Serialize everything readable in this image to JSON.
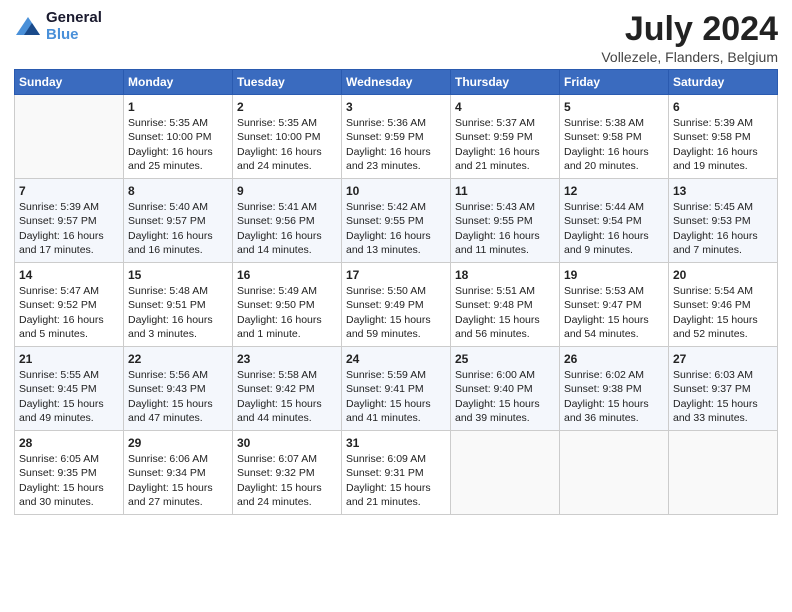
{
  "header": {
    "logo_line1": "General",
    "logo_line2": "Blue",
    "title": "July 2024",
    "subtitle": "Vollezele, Flanders, Belgium"
  },
  "weekdays": [
    "Sunday",
    "Monday",
    "Tuesday",
    "Wednesday",
    "Thursday",
    "Friday",
    "Saturday"
  ],
  "weeks": [
    [
      {
        "empty": true
      },
      {
        "day": "1",
        "sunrise": "5:35 AM",
        "sunset": "10:00 PM",
        "daylight": "16 hours and 25 minutes."
      },
      {
        "day": "2",
        "sunrise": "5:35 AM",
        "sunset": "10:00 PM",
        "daylight": "16 hours and 24 minutes."
      },
      {
        "day": "3",
        "sunrise": "5:36 AM",
        "sunset": "9:59 PM",
        "daylight": "16 hours and 23 minutes."
      },
      {
        "day": "4",
        "sunrise": "5:37 AM",
        "sunset": "9:59 PM",
        "daylight": "16 hours and 21 minutes."
      },
      {
        "day": "5",
        "sunrise": "5:38 AM",
        "sunset": "9:58 PM",
        "daylight": "16 hours and 20 minutes."
      },
      {
        "day": "6",
        "sunrise": "5:39 AM",
        "sunset": "9:58 PM",
        "daylight": "16 hours and 19 minutes."
      }
    ],
    [
      {
        "day": "7",
        "sunrise": "5:39 AM",
        "sunset": "9:57 PM",
        "daylight": "16 hours and 17 minutes."
      },
      {
        "day": "8",
        "sunrise": "5:40 AM",
        "sunset": "9:57 PM",
        "daylight": "16 hours and 16 minutes."
      },
      {
        "day": "9",
        "sunrise": "5:41 AM",
        "sunset": "9:56 PM",
        "daylight": "16 hours and 14 minutes."
      },
      {
        "day": "10",
        "sunrise": "5:42 AM",
        "sunset": "9:55 PM",
        "daylight": "16 hours and 13 minutes."
      },
      {
        "day": "11",
        "sunrise": "5:43 AM",
        "sunset": "9:55 PM",
        "daylight": "16 hours and 11 minutes."
      },
      {
        "day": "12",
        "sunrise": "5:44 AM",
        "sunset": "9:54 PM",
        "daylight": "16 hours and 9 minutes."
      },
      {
        "day": "13",
        "sunrise": "5:45 AM",
        "sunset": "9:53 PM",
        "daylight": "16 hours and 7 minutes."
      }
    ],
    [
      {
        "day": "14",
        "sunrise": "5:47 AM",
        "sunset": "9:52 PM",
        "daylight": "16 hours and 5 minutes."
      },
      {
        "day": "15",
        "sunrise": "5:48 AM",
        "sunset": "9:51 PM",
        "daylight": "16 hours and 3 minutes."
      },
      {
        "day": "16",
        "sunrise": "5:49 AM",
        "sunset": "9:50 PM",
        "daylight": "16 hours and 1 minute."
      },
      {
        "day": "17",
        "sunrise": "5:50 AM",
        "sunset": "9:49 PM",
        "daylight": "15 hours and 59 minutes."
      },
      {
        "day": "18",
        "sunrise": "5:51 AM",
        "sunset": "9:48 PM",
        "daylight": "15 hours and 56 minutes."
      },
      {
        "day": "19",
        "sunrise": "5:53 AM",
        "sunset": "9:47 PM",
        "daylight": "15 hours and 54 minutes."
      },
      {
        "day": "20",
        "sunrise": "5:54 AM",
        "sunset": "9:46 PM",
        "daylight": "15 hours and 52 minutes."
      }
    ],
    [
      {
        "day": "21",
        "sunrise": "5:55 AM",
        "sunset": "9:45 PM",
        "daylight": "15 hours and 49 minutes."
      },
      {
        "day": "22",
        "sunrise": "5:56 AM",
        "sunset": "9:43 PM",
        "daylight": "15 hours and 47 minutes."
      },
      {
        "day": "23",
        "sunrise": "5:58 AM",
        "sunset": "9:42 PM",
        "daylight": "15 hours and 44 minutes."
      },
      {
        "day": "24",
        "sunrise": "5:59 AM",
        "sunset": "9:41 PM",
        "daylight": "15 hours and 41 minutes."
      },
      {
        "day": "25",
        "sunrise": "6:00 AM",
        "sunset": "9:40 PM",
        "daylight": "15 hours and 39 minutes."
      },
      {
        "day": "26",
        "sunrise": "6:02 AM",
        "sunset": "9:38 PM",
        "daylight": "15 hours and 36 minutes."
      },
      {
        "day": "27",
        "sunrise": "6:03 AM",
        "sunset": "9:37 PM",
        "daylight": "15 hours and 33 minutes."
      }
    ],
    [
      {
        "day": "28",
        "sunrise": "6:05 AM",
        "sunset": "9:35 PM",
        "daylight": "15 hours and 30 minutes."
      },
      {
        "day": "29",
        "sunrise": "6:06 AM",
        "sunset": "9:34 PM",
        "daylight": "15 hours and 27 minutes."
      },
      {
        "day": "30",
        "sunrise": "6:07 AM",
        "sunset": "9:32 PM",
        "daylight": "15 hours and 24 minutes."
      },
      {
        "day": "31",
        "sunrise": "6:09 AM",
        "sunset": "9:31 PM",
        "daylight": "15 hours and 21 minutes."
      },
      {
        "empty": true
      },
      {
        "empty": true
      },
      {
        "empty": true
      }
    ]
  ]
}
